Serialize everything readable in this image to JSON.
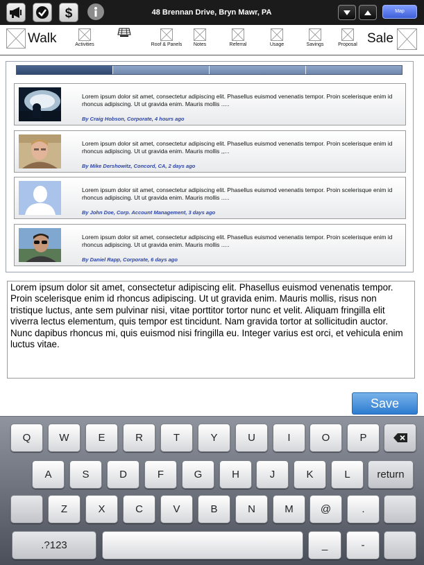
{
  "header": {
    "title": "48 Brennan Drive, Bryn Mawr, PA",
    "map_label": "Map"
  },
  "toolbar": {
    "walk_label": "Walk",
    "sale_label": "Sale",
    "items": [
      {
        "label": "Activities"
      },
      {
        "label": ""
      },
      {
        "label": "Roof & Panels"
      },
      {
        "label": "Notes"
      },
      {
        "label": "Referral"
      },
      {
        "label": "Usage"
      },
      {
        "label": "Savings"
      },
      {
        "label": "Proposal"
      }
    ]
  },
  "feed": {
    "items": [
      {
        "text": "Lorem ipsum dolor sit amet, consectetur adipiscing elit. Phasellus euismod venenatis tempor. Proin scelerisque enim id rhoncus adipiscing. Ut ut gravida enim. Mauris mollis .....",
        "meta": "By Craig Hobson, Corporate, 4 hours ago",
        "avatar": "night-photo"
      },
      {
        "text": "Lorem ipsum dolor sit amet, consectetur adipiscing elit. Phasellus euismod venenatis tempor. Proin scelerisque enim id rhoncus adipiscing. Ut ut gravida enim. Mauris mollis ,,...",
        "meta": "By Mike Dershowitz, Concord, CA, 2 days ago",
        "avatar": "man-photo"
      },
      {
        "text": "Lorem ipsum dolor sit amet, consectetur adipiscing elit. Phasellus euismod venenatis tempor. Proin scelerisque enim id rhoncus adipiscing. Ut ut gravida enim. Mauris mollis .....",
        "meta": "By John Doe, Corp. Account Management, 3 days ago",
        "avatar": "default-silhouette"
      },
      {
        "text": "Lorem ipsum dolor sit amet, consectetur adipiscing elit. Phasellus euismod venenatis tempor. Proin scelerisque enim id rhoncus adipiscing. Ut ut gravida enim. Mauris mollis .....",
        "meta": "By Daniel Rapp, Corporate, 6 days ago",
        "avatar": "sunglasses-photo"
      }
    ]
  },
  "notes": {
    "value": "Lorem ipsum dolor sit amet, consectetur adipiscing elit. Phasellus euismod venenatis tempor. Proin scelerisque enim id rhoncus adipiscing. Ut ut gravida enim. Mauris mollis, risus non tristique luctus, ante sem pulvinar nisi, vitae porttitor tortor nunc et velit. Aliquam fringilla elit viverra lectus elementum, quis tempor est tincidunt. Nam gravida tortor at sollicitudin auctor. Nunc dapibus rhoncus mi, quis euismod nisi fringilla eu. Integer varius est orci, et vehicula enim luctus vitae."
  },
  "save_label": "Save",
  "keyboard": {
    "row1": [
      "Q",
      "W",
      "E",
      "R",
      "T",
      "Y",
      "U",
      "I",
      "O",
      "P"
    ],
    "row2": [
      "A",
      "S",
      "D",
      "F",
      "G",
      "H",
      "J",
      "K",
      "L"
    ],
    "row3": [
      "Z",
      "X",
      "C",
      "V",
      "B",
      "N",
      "M",
      "@",
      "."
    ],
    "return_label": "return",
    "numbers_label": ".?123",
    "underscore_label": "_",
    "dash_label": "-"
  },
  "colors": {
    "accent": "#2d7bd0",
    "meta_text": "#2d46a6",
    "topbar": "#1b1b1b"
  }
}
